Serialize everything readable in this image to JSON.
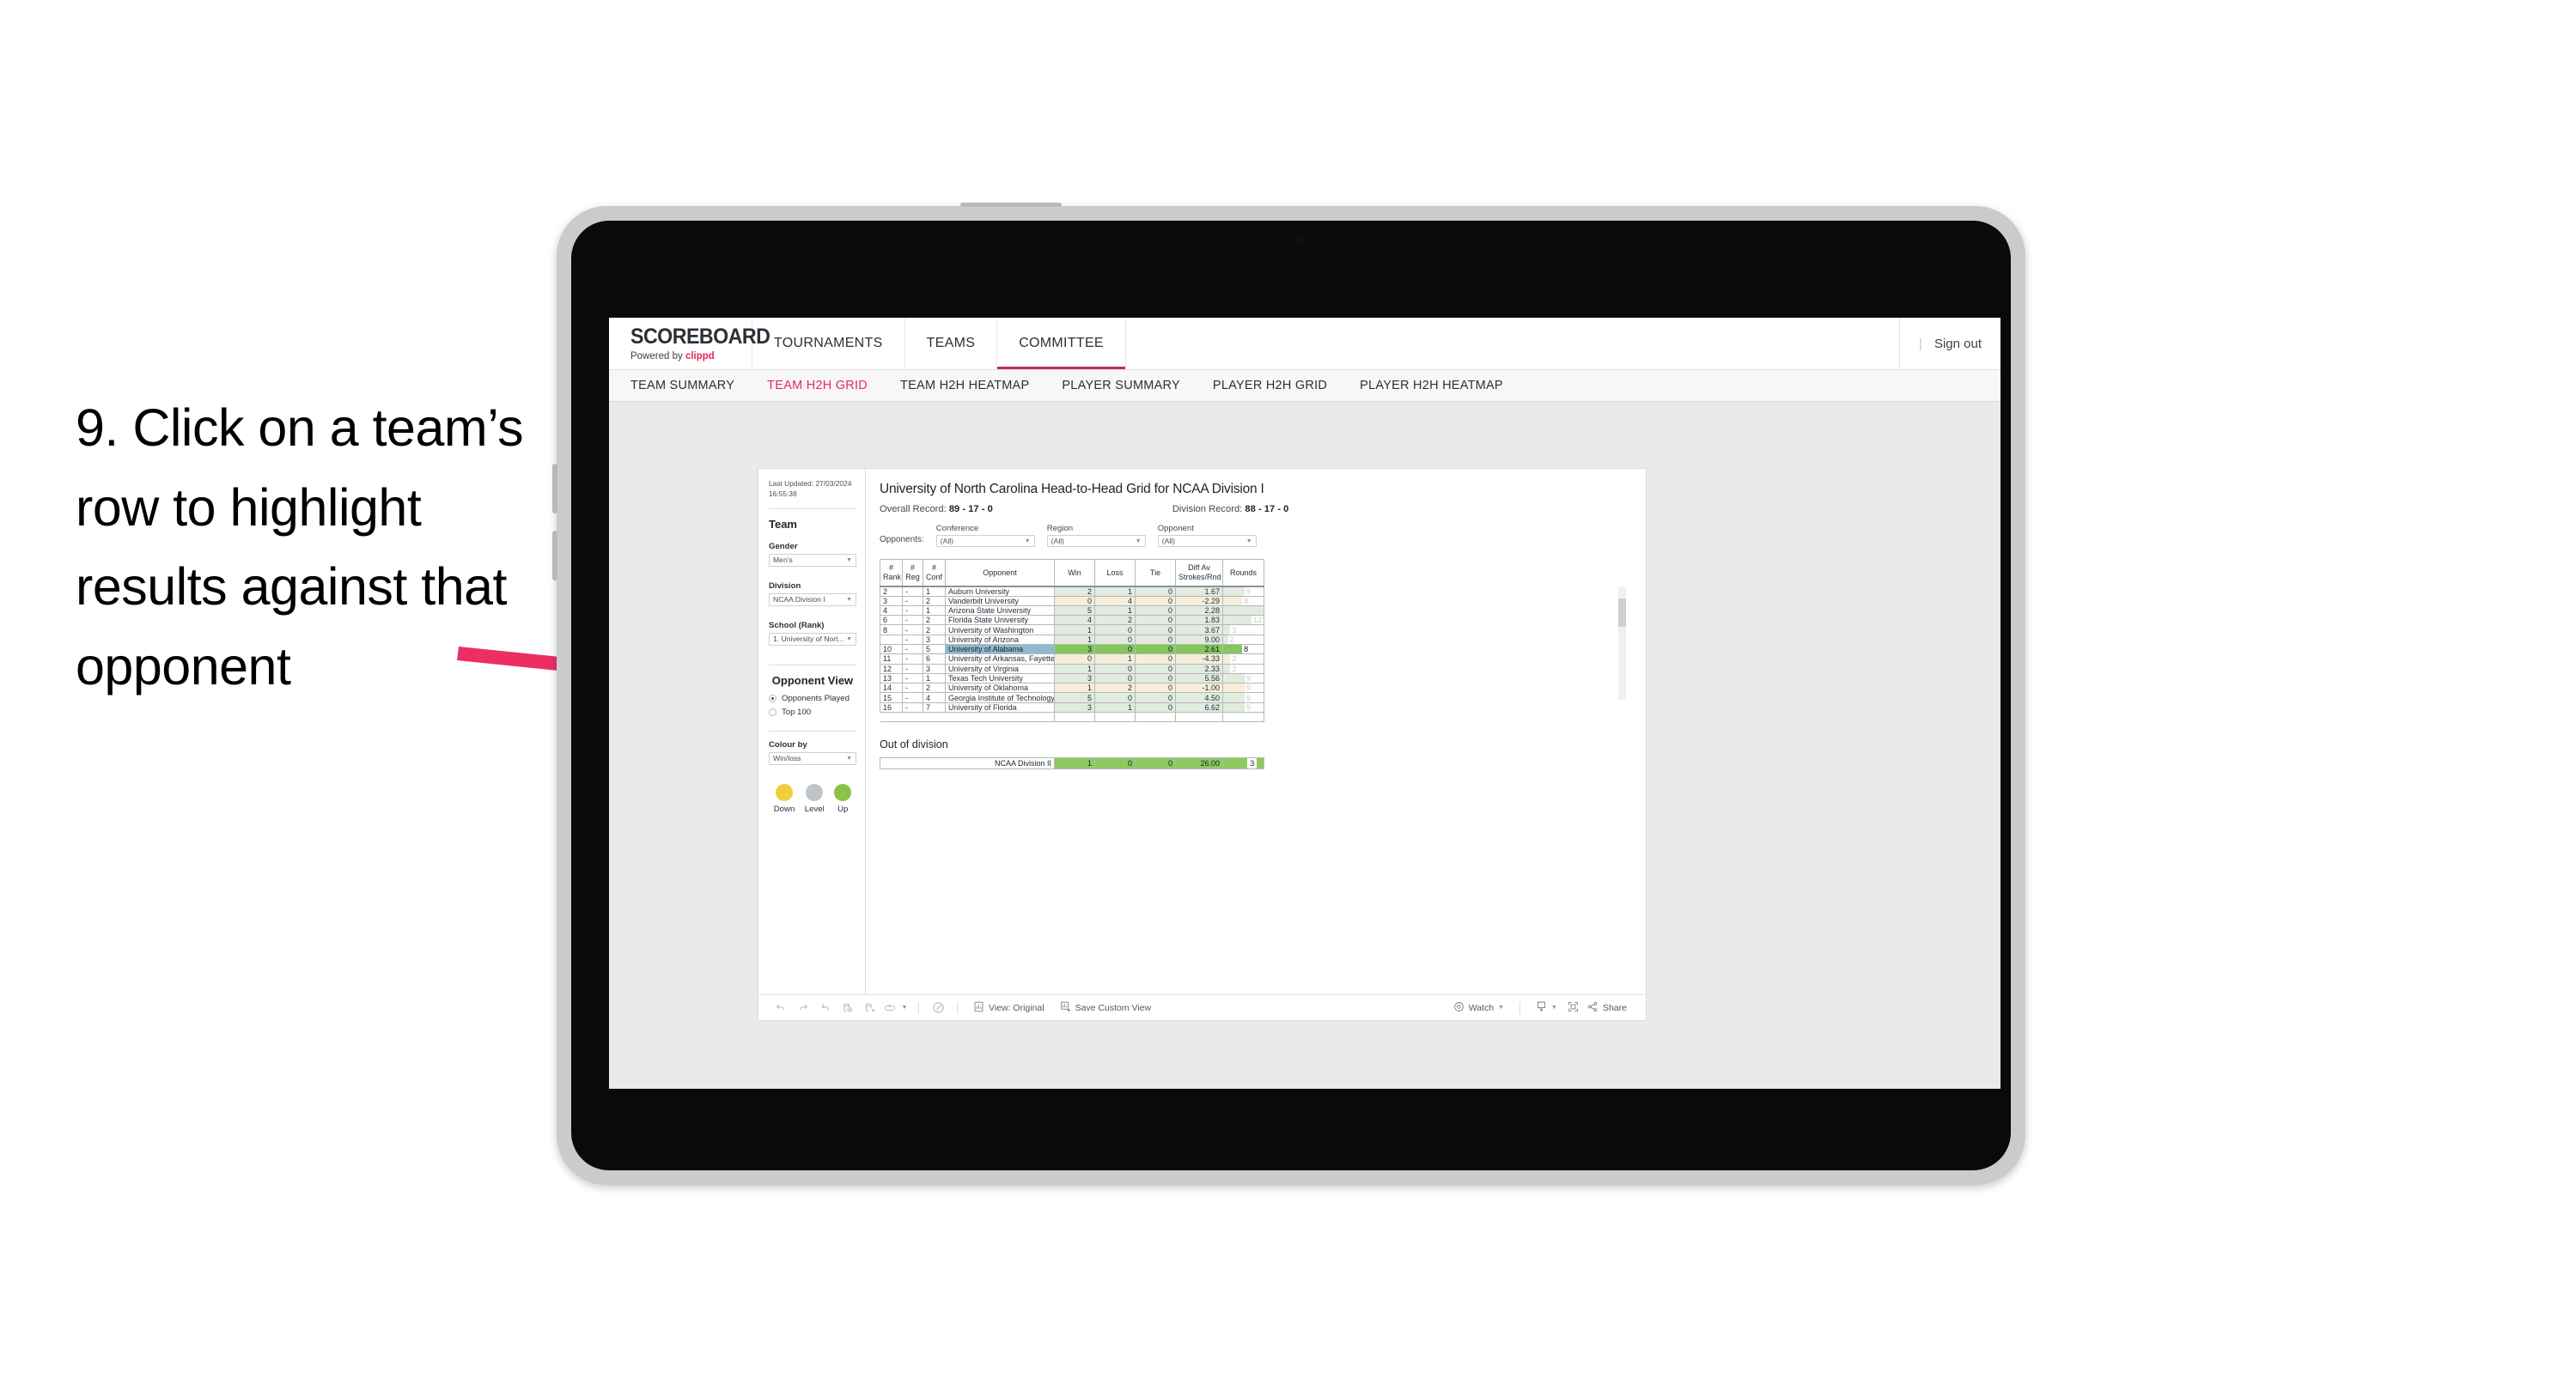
{
  "annotation": {
    "text": "9. Click on a team’s row to highlight results against that opponent",
    "arrow_color": "#ed2e63"
  },
  "navbar": {
    "brand_title": "SCOREBOARD",
    "brand_sub_prefix": "Powered by ",
    "brand_sub_name": "clippd",
    "items": [
      {
        "label": "TOURNAMENTS",
        "active": false
      },
      {
        "label": "TEAMS",
        "active": false
      },
      {
        "label": "COMMITTEE",
        "active": true
      }
    ],
    "separator": "|",
    "sign_out": "Sign out"
  },
  "subnav": {
    "items": [
      {
        "label": "TEAM SUMMARY",
        "active": false
      },
      {
        "label": "TEAM H2H GRID",
        "active": true
      },
      {
        "label": "TEAM H2H HEATMAP",
        "active": false
      },
      {
        "label": "PLAYER SUMMARY",
        "active": false
      },
      {
        "label": "PLAYER H2H GRID",
        "active": false
      },
      {
        "label": "PLAYER H2H HEATMAP",
        "active": false
      }
    ],
    "active_color": "#e8275a"
  },
  "sidebar": {
    "last_updated": "Last Updated: 27/03/2024 16:55:38",
    "team_heading": "Team",
    "gender_label": "Gender",
    "gender_value": "Men’s",
    "division_label": "Division",
    "division_value": "NCAA Division I",
    "school_label": "School (Rank)",
    "school_value": "1. University of Nort...",
    "opponent_view_heading": "Opponent View",
    "opponent_view_options": [
      {
        "label": "Opponents Played",
        "selected": true
      },
      {
        "label": "Top 100",
        "selected": false
      }
    ],
    "colour_by_label": "Colour by",
    "colour_by_value": "Win/loss",
    "legend": [
      {
        "label": "Down",
        "color": "#f2ce3e"
      },
      {
        "label": "Level",
        "color": "#bfc4c8"
      },
      {
        "label": "Up",
        "color": "#8bc34a"
      }
    ]
  },
  "main": {
    "title": "University of North Carolina Head-to-Head Grid for NCAA Division I",
    "overall_record_label": "Overall Record:",
    "overall_record_value": "89 - 17 - 0",
    "division_record_label": "Division Record:",
    "division_record_value": "88 - 17 - 0",
    "opponents_label": "Opponents:",
    "filters": [
      {
        "label": "Conference",
        "value": "(All)"
      },
      {
        "label": "Region",
        "value": "(All)"
      },
      {
        "label": "Opponent",
        "value": "(All)"
      }
    ],
    "out_of_division_title": "Out of division"
  },
  "chart_data": {
    "type": "table",
    "title": "University of North Carolina Head-to-Head Grid for NCAA Division I",
    "columns": [
      "# Rank",
      "# Reg",
      "# Conf",
      "Opponent",
      "Win",
      "Loss",
      "Tie",
      "Diff Av Strokes/Rnd",
      "Rounds"
    ],
    "column_header_lines": [
      [
        "#",
        "Rank"
      ],
      [
        "#",
        "Reg"
      ],
      [
        "#",
        "Conf"
      ],
      [
        "Opponent"
      ],
      [
        "Win"
      ],
      [
        "Loss"
      ],
      [
        "Tie"
      ],
      [
        "Diff Av",
        "Strokes/Rnd"
      ],
      [
        "Rounds"
      ]
    ],
    "rounds_max": 17,
    "highlighted_row_index": 6,
    "rows": [
      {
        "rank": "2",
        "reg": "-",
        "conf": "1",
        "opponent": "Auburn University",
        "win": "2",
        "loss": "1",
        "tie": "0",
        "diff": "1.67",
        "rounds": "9",
        "tone": "up",
        "highlight": false
      },
      {
        "rank": "3",
        "reg": "-",
        "conf": "2",
        "opponent": "Vanderbilt University",
        "win": "0",
        "loss": "4",
        "tie": "0",
        "diff": "-2.29",
        "rounds": "8",
        "tone": "down",
        "highlight": false
      },
      {
        "rank": "4",
        "reg": "-",
        "conf": "1",
        "opponent": "Arizona State University",
        "win": "5",
        "loss": "1",
        "tie": "0",
        "diff": "2.28",
        "rounds": "17",
        "tone": "up",
        "highlight": false
      },
      {
        "rank": "6",
        "reg": "-",
        "conf": "2",
        "opponent": "Florida State University",
        "win": "4",
        "loss": "2",
        "tie": "0",
        "diff": "1.83",
        "rounds": "12",
        "tone": "up",
        "highlight": false
      },
      {
        "rank": "8",
        "reg": "-",
        "conf": "2",
        "opponent": "University of Washington",
        "win": "1",
        "loss": "0",
        "tie": "0",
        "diff": "3.67",
        "rounds": "3",
        "tone": "up",
        "highlight": false
      },
      {
        "rank": "",
        "reg": "-",
        "conf": "3",
        "opponent": "University of Arizona",
        "win": "1",
        "loss": "0",
        "tie": "0",
        "diff": "9.00",
        "rounds": "2",
        "tone": "up",
        "highlight": false
      },
      {
        "rank": "10",
        "reg": "-",
        "conf": "5",
        "opponent": "University of Alabama",
        "win": "3",
        "loss": "0",
        "tie": "0",
        "diff": "2.61",
        "rounds": "8",
        "tone": "up",
        "highlight": true
      },
      {
        "rank": "11",
        "reg": "-",
        "conf": "6",
        "opponent": "University of Arkansas, Fayetteville",
        "win": "0",
        "loss": "1",
        "tie": "0",
        "diff": "-4.33",
        "rounds": "3",
        "tone": "down",
        "highlight": false
      },
      {
        "rank": "12",
        "reg": "-",
        "conf": "3",
        "opponent": "University of Virginia",
        "win": "1",
        "loss": "0",
        "tie": "0",
        "diff": "2.33",
        "rounds": "3",
        "tone": "up",
        "highlight": false
      },
      {
        "rank": "13",
        "reg": "-",
        "conf": "1",
        "opponent": "Texas Tech University",
        "win": "3",
        "loss": "0",
        "tie": "0",
        "diff": "5.56",
        "rounds": "9",
        "tone": "up",
        "highlight": false
      },
      {
        "rank": "14",
        "reg": "-",
        "conf": "2",
        "opponent": "University of Oklahoma",
        "win": "1",
        "loss": "2",
        "tie": "0",
        "diff": "-1.00",
        "rounds": "9",
        "tone": "down",
        "highlight": false
      },
      {
        "rank": "15",
        "reg": "-",
        "conf": "4",
        "opponent": "Georgia Institute of Technology",
        "win": "5",
        "loss": "0",
        "tie": "0",
        "diff": "4.50",
        "rounds": "9",
        "tone": "up",
        "highlight": false
      },
      {
        "rank": "16",
        "reg": "-",
        "conf": "7",
        "opponent": "University of Florida",
        "win": "3",
        "loss": "1",
        "tie": "0",
        "diff": "6.62",
        "rounds": "9",
        "tone": "up",
        "highlight": false
      }
    ],
    "out_of_division": {
      "label": "NCAA Division II",
      "win": "1",
      "loss": "0",
      "tie": "0",
      "diff": "26.00",
      "rounds": "3"
    }
  },
  "toolbar": {
    "view_label": "View: Original",
    "save_view_label": "Save Custom View",
    "watch_label": "Watch",
    "share_label": "Share"
  }
}
